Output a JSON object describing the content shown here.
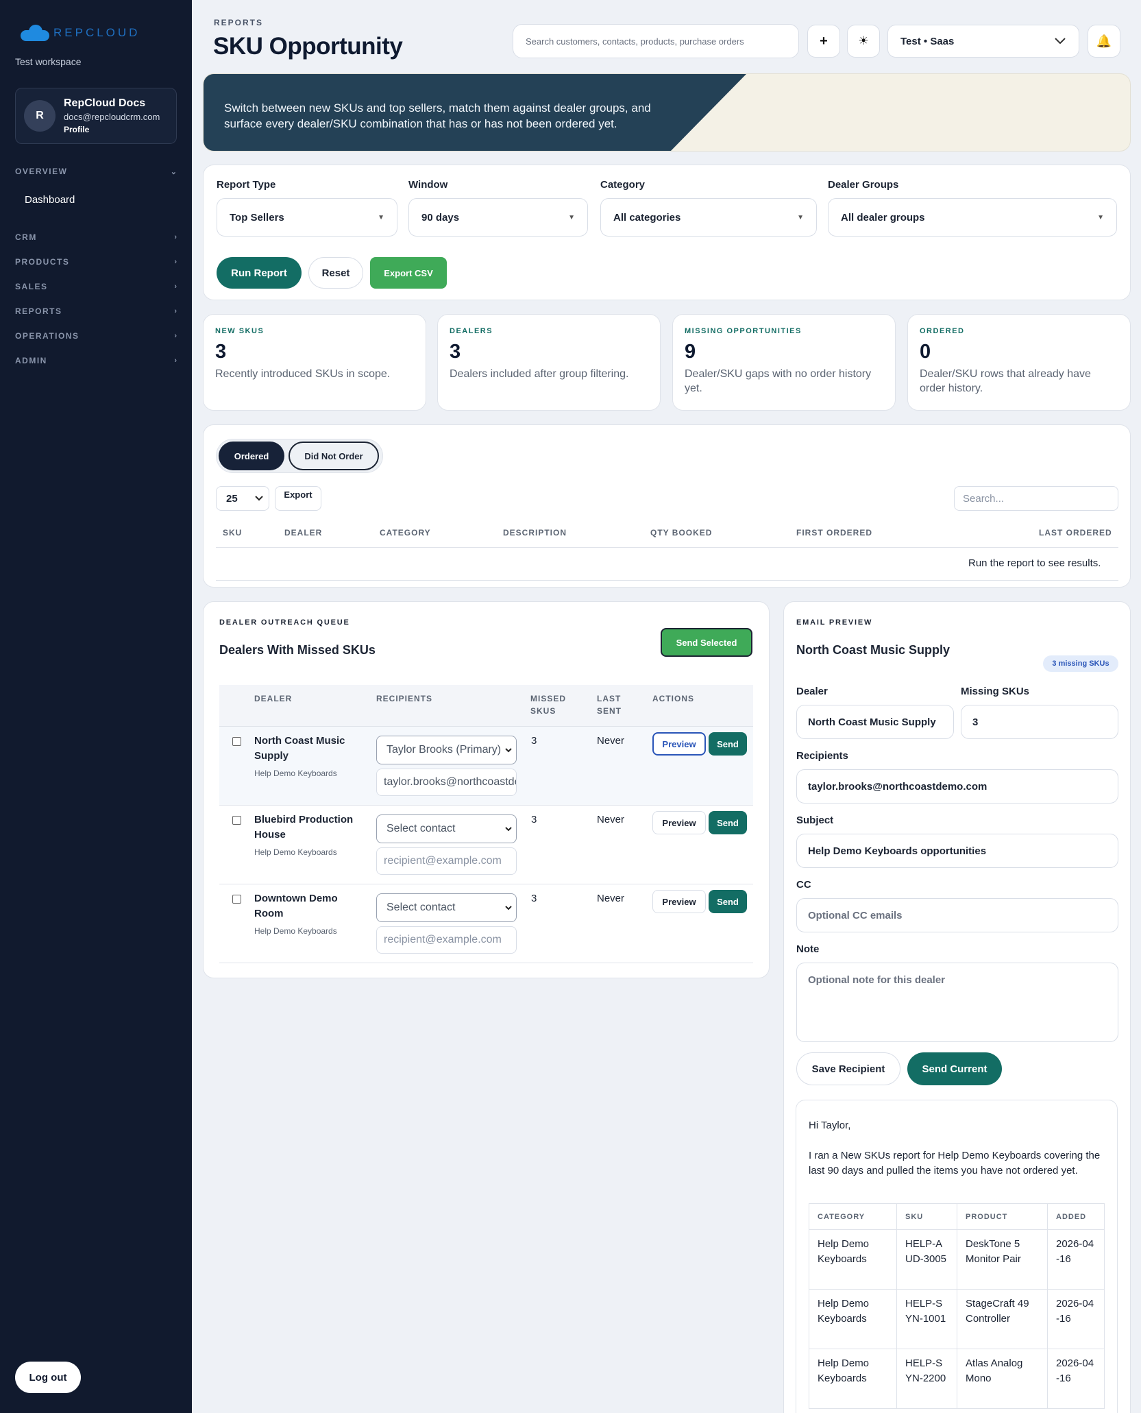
{
  "sidebar": {
    "logo_text": "REPCLOUD",
    "workspace": "Test workspace",
    "profile": {
      "initial": "R",
      "name": "RepCloud Docs",
      "email": "docs@repcloudcrm.com",
      "link": "Profile"
    },
    "sections": [
      {
        "label": "OVERVIEW",
        "chevron": "⌄"
      },
      {
        "label": "CRM",
        "chevron": "›"
      },
      {
        "label": "PRODUCTS",
        "chevron": "›"
      },
      {
        "label": "SALES",
        "chevron": "›"
      },
      {
        "label": "REPORTS",
        "chevron": "›"
      },
      {
        "label": "OPERATIONS",
        "chevron": "›"
      },
      {
        "label": "ADMIN",
        "chevron": "›"
      }
    ],
    "dashboard_label": "Dashboard",
    "logout_label": "Log out"
  },
  "header": {
    "eyebrow": "REPORTS",
    "title": "SKU Opportunity",
    "search_placeholder": "Search customers, contacts, products, purchase orders",
    "add_icon": "+",
    "theme_icon": "☀",
    "tenant": "Test • Saas",
    "bell_icon": "🔔"
  },
  "banner": {
    "text": "Switch between new SKUs and top sellers, match them against dealer groups, and surface every dealer/SKU combination that has or has not been ordered yet."
  },
  "filters": {
    "report_type": {
      "label": "Report Type",
      "value": "Top Sellers"
    },
    "window": {
      "label": "Window",
      "value": "90 days"
    },
    "category": {
      "label": "Category",
      "value": "All categories"
    },
    "dealer_groups": {
      "label": "Dealer Groups",
      "value": "All dealer groups"
    },
    "run_label": "Run Report",
    "reset_label": "Reset",
    "export_label": "Export CSV"
  },
  "stats": [
    {
      "label": "NEW SKUS",
      "value": "3",
      "desc": "Recently introduced SKUs in scope."
    },
    {
      "label": "DEALERS",
      "value": "3",
      "desc": "Dealers included after group filtering."
    },
    {
      "label": "MISSING OPPORTUNITIES",
      "value": "9",
      "desc": "Dealer/SKU gaps with no order history yet."
    },
    {
      "label": "ORDERED",
      "value": "0",
      "desc": "Dealer/SKU rows that already have order history."
    }
  ],
  "results": {
    "tab_ordered": "Ordered",
    "tab_not_ordered": "Did Not Order",
    "page_size": "25",
    "export_label": "Export",
    "search_placeholder": "Search...",
    "columns": [
      "SKU",
      "DEALER",
      "CATEGORY",
      "DESCRIPTION",
      "QTY BOOKED",
      "FIRST ORDERED",
      "LAST ORDERED"
    ],
    "empty_text": "Run the report to see results."
  },
  "queue": {
    "eyebrow": "DEALER OUTREACH QUEUE",
    "title": "Dealers With Missed SKUs",
    "send_selected": "Send Selected",
    "columns": {
      "dealer": "DEALER",
      "recipients": "RECIPIENTS",
      "missed_1": "MISSED",
      "missed_2": "SKUS",
      "last_1": "LAST",
      "last_2": "SENT",
      "actions": "ACTIONS"
    },
    "rows": [
      {
        "name": "North Coast Music Supply",
        "sub": "Help Demo Keyboards",
        "contact": "Taylor Brooks (Primary)",
        "email": "taylor.brooks@northcoastdemo.com",
        "missed": "3",
        "last": "Never"
      },
      {
        "name": "Bluebird Production House",
        "sub": "Help Demo Keyboards",
        "contact": "Select contact",
        "email": "recipient@example.com",
        "missed": "3",
        "last": "Never"
      },
      {
        "name": "Downtown Demo Room",
        "sub": "Help Demo Keyboards",
        "contact": "Select contact",
        "email": "recipient@example.com",
        "missed": "3",
        "last": "Never"
      }
    ],
    "preview_label": "Preview",
    "send_label": "Send"
  },
  "email": {
    "eyebrow": "EMAIL PREVIEW",
    "title": "North Coast Music Supply",
    "badge": "3 missing SKUs",
    "dealer_label": "Dealer",
    "dealer_value": "North Coast Music Supply",
    "missing_label": "Missing SKUs",
    "missing_value": "3",
    "recipients_label": "Recipients",
    "recipients_value": "taylor.brooks@northcoastdemo.com",
    "subject_label": "Subject",
    "subject_value": "Help Demo Keyboards opportunities",
    "cc_label": "CC",
    "cc_placeholder": "Optional CC emails",
    "note_label": "Note",
    "note_placeholder": "Optional note for this dealer",
    "save_label": "Save Recipient",
    "send_label": "Send Current",
    "greeting": "Hi Taylor,",
    "body": "I ran a New SKUs report for Help Demo Keyboards covering the last 90 days and pulled the items you have not ordered yet.",
    "table_columns": [
      "CATEGORY",
      "SKU",
      "PRODUCT",
      "ADDED"
    ],
    "table_rows": [
      [
        "Help Demo Keyboards",
        "HELP-AUD-3005",
        "DeskTone 5 Monitor Pair",
        "2026-04-16"
      ],
      [
        "Help Demo Keyboards",
        "HELP-SYN-1001",
        "StageCraft 49 Controller",
        "2026-04-16"
      ],
      [
        "Help Demo Keyboards",
        "HELP-SYN-2200",
        "Atlas Analog Mono",
        "2026-04-16"
      ]
    ]
  }
}
